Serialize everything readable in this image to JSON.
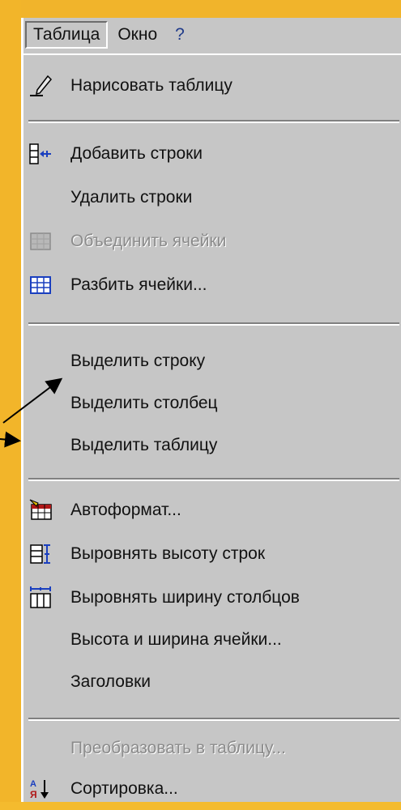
{
  "menubar": {
    "items": [
      {
        "label": "Таблица",
        "open": true
      },
      {
        "label": "Окно"
      },
      {
        "label": "?"
      }
    ]
  },
  "menu": {
    "items": [
      {
        "label": "Нарисовать таблицу",
        "icon": "pencil-icon",
        "enabled": true
      },
      {
        "label": "Добавить строки",
        "icon": "insert-rows-icon",
        "enabled": true
      },
      {
        "label": "Удалить строки",
        "enabled": true
      },
      {
        "label": "Объединить ячейки",
        "icon": "merge-cells-icon",
        "enabled": false
      },
      {
        "label": "Разбить ячейки...",
        "icon": "split-cells-icon",
        "enabled": true
      },
      {
        "label": "Выделить строку",
        "enabled": true
      },
      {
        "label": "Выделить столбец",
        "enabled": true
      },
      {
        "label": "Выделить таблицу",
        "enabled": true
      },
      {
        "label": "Автоформат...",
        "icon": "autoformat-icon",
        "enabled": true
      },
      {
        "label": "Выровнять высоту строк",
        "icon": "distribute-rows-icon",
        "enabled": true
      },
      {
        "label": "Выровнять ширину столбцов",
        "icon": "distribute-columns-icon",
        "enabled": true
      },
      {
        "label": "Высота и ширина ячейки...",
        "enabled": true
      },
      {
        "label": "Заголовки",
        "enabled": true
      },
      {
        "label": "Преобразовать в таблицу...",
        "enabled": false
      },
      {
        "label": "Сортировка...",
        "icon": "sort-icon",
        "enabled": true
      }
    ]
  },
  "colors": {
    "background": "#f4bb2e",
    "menu": "#c6c6c6",
    "disabled_text": "#8b8b8b"
  }
}
